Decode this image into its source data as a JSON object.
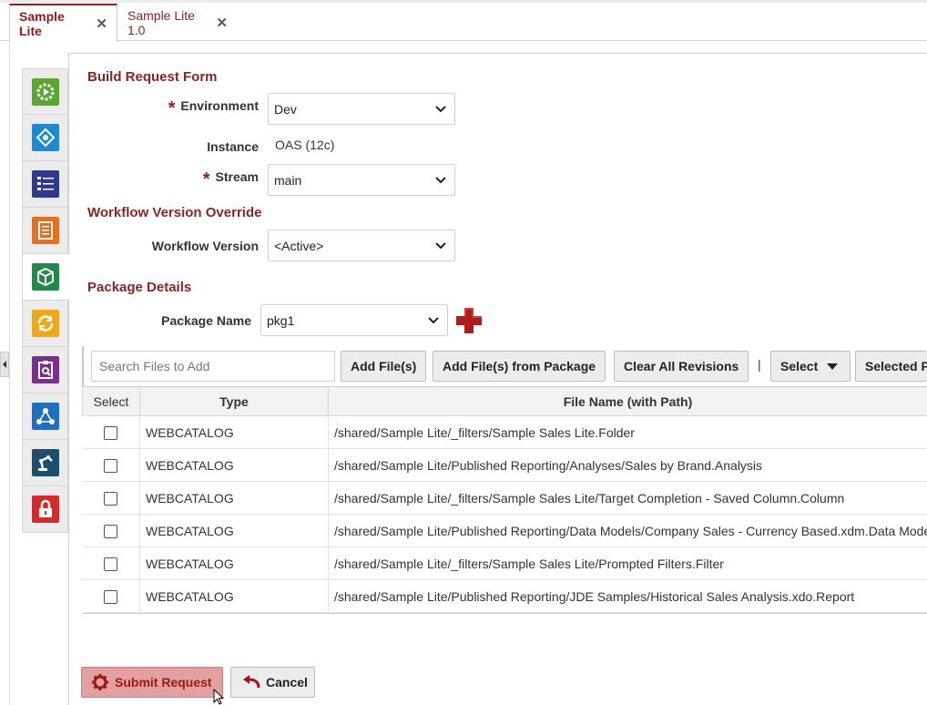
{
  "tabs": [
    {
      "label": "Sample Lite",
      "close": "✕",
      "active": true
    },
    {
      "label": "Sample Lite 1.0",
      "close": "✕",
      "active": false
    }
  ],
  "rail": {
    "items": [
      {
        "icon": "gear-play-icon",
        "color": "#5aa832"
      },
      {
        "icon": "network-diamond-icon",
        "color": "#1e88d2"
      },
      {
        "icon": "checklist-icon",
        "color": "#2e3a8f"
      },
      {
        "icon": "document-icon",
        "color": "#e86f1c"
      },
      {
        "icon": "package-cube-icon",
        "color": "#1f8a4a"
      },
      {
        "icon": "refresh-icon",
        "color": "#f0a818"
      },
      {
        "icon": "clipboard-search-icon",
        "color": "#7a2f8f"
      },
      {
        "icon": "workflow-nodes-icon",
        "color": "#1e6fbf"
      },
      {
        "icon": "robot-arm-icon",
        "color": "#1d4e6e"
      },
      {
        "icon": "lock-icon",
        "color": "#d42a2a"
      }
    ],
    "active_index": 4
  },
  "form": {
    "title": "Build Request Form",
    "required_marker": "*",
    "environment": {
      "label": "Environment",
      "value": "Dev"
    },
    "instance": {
      "label": "Instance",
      "value": "OAS (12c)"
    },
    "stream": {
      "label": "Stream",
      "value": "main"
    },
    "override_title": "Workflow Version Override",
    "workflow_version": {
      "label": "Workflow Version",
      "value": "<Active>"
    },
    "package_title": "Package Details",
    "package_name": {
      "label": "Package Name",
      "value": "pkg1"
    }
  },
  "toolbar": {
    "search_placeholder": "Search Files to Add",
    "add_files": "Add File(s)",
    "add_from_package": "Add File(s) from Package",
    "clear_revisions": "Clear All Revisions",
    "separator": "|",
    "select": "Select",
    "selected": "Selected Files"
  },
  "table": {
    "headers": [
      "Select",
      "Type",
      "File Name (with Path)"
    ],
    "rows": [
      {
        "type": "WEBCATALOG",
        "file": "/shared/Sample Lite/_filters/Sample Sales Lite.Folder",
        "checked": false
      },
      {
        "type": "WEBCATALOG",
        "file": "/shared/Sample Lite/Published Reporting/Analyses/Sales by Brand.Analysis",
        "checked": false
      },
      {
        "type": "WEBCATALOG",
        "file": "/shared/Sample Lite/_filters/Sample Sales Lite/Target Completion - Saved Column.Column",
        "checked": false
      },
      {
        "type": "WEBCATALOG",
        "file": "/shared/Sample Lite/Published Reporting/Data Models/Company Sales - Currency Based.xdm.Data Model",
        "checked": false
      },
      {
        "type": "WEBCATALOG",
        "file": "/shared/Sample Lite/_filters/Sample Sales Lite/Prompted Filters.Filter",
        "checked": false
      },
      {
        "type": "WEBCATALOG",
        "file": "/shared/Sample Lite/Published Reporting/JDE Samples/Historical Sales Analysis.xdo.Report",
        "checked": false
      }
    ]
  },
  "footer": {
    "submit": "Submit Request",
    "cancel": "Cancel"
  },
  "colors": {
    "accent": "#8b2323",
    "submit_bg": "#e3a0a0",
    "plus": "#b01c1c"
  }
}
